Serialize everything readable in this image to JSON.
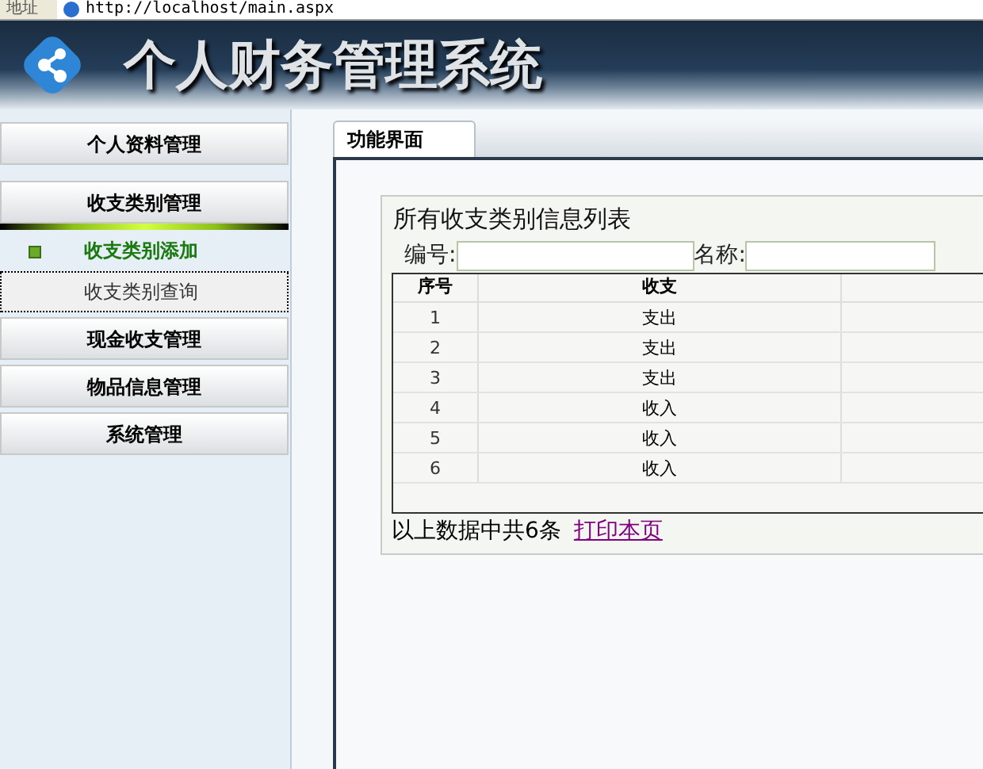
{
  "address_bar": {
    "label": "地址",
    "url": "http://localhost/main.aspx"
  },
  "header": {
    "title": "个人财务管理系统"
  },
  "sidebar": {
    "items": [
      {
        "label": "个人资料管理",
        "expanded": false
      },
      {
        "label": "收支类别管理",
        "expanded": true,
        "children": [
          {
            "label": "收支类别添加",
            "selected": true,
            "focused": false
          },
          {
            "label": "收支类别查询",
            "selected": false,
            "focused": true
          }
        ]
      },
      {
        "label": "现金收支管理",
        "expanded": false
      },
      {
        "label": "物品信息管理",
        "expanded": false
      },
      {
        "label": "系统管理",
        "expanded": false
      }
    ]
  },
  "tabs": [
    {
      "label": "功能界面",
      "selected": true
    }
  ],
  "panel": {
    "title": "所有收支类别信息列表",
    "filters": [
      {
        "label": "编号:"
      },
      {
        "label": "名称:"
      }
    ],
    "table": {
      "columns": [
        "序号",
        "收支"
      ],
      "rows": [
        [
          "1",
          "支出"
        ],
        [
          "2",
          "支出"
        ],
        [
          "3",
          "支出"
        ],
        [
          "4",
          "收入"
        ],
        [
          "5",
          "收入"
        ],
        [
          "6",
          "收入"
        ]
      ]
    },
    "summary": "以上数据中共6条",
    "print_link": "打印本页"
  }
}
